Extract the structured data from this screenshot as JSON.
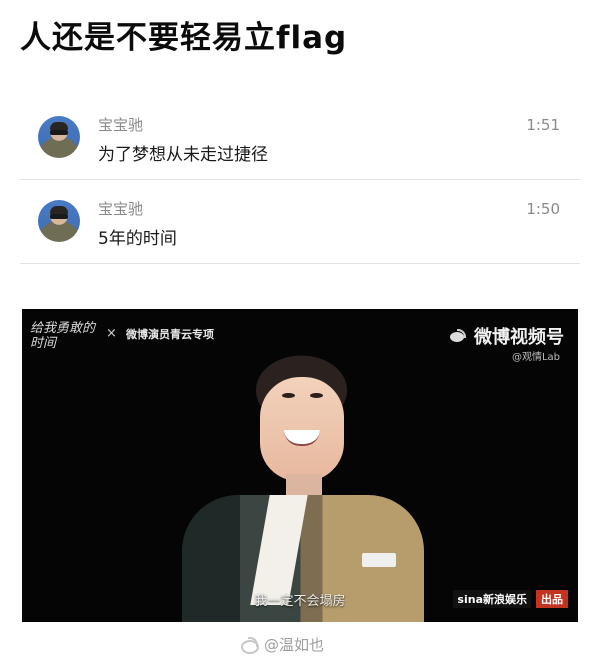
{
  "page": {
    "title": "人还是不要轻易立flag"
  },
  "messages": [
    {
      "sender": "宝宝驰",
      "text": "为了梦想从未走过捷径",
      "time": "1:51",
      "avatar_icon": "sunglasses-avatar"
    },
    {
      "sender": "宝宝驰",
      "text": "5年的时间",
      "time": "1:50",
      "avatar_icon": "sunglasses-avatar"
    }
  ],
  "video": {
    "left_logo": "给我勇敢的时间",
    "collab_x": "×",
    "collab_title": "微博演员青云专项",
    "platform": "微博视频号",
    "platform_sub": "@观情Lab",
    "subtitle": "我一定不会塌房",
    "brand": "sina新浪娱乐",
    "badge": "出品"
  },
  "watermark": {
    "text": "@温如也",
    "icon": "weibo-icon"
  },
  "colors": {
    "text_primary": "#111111",
    "text_secondary": "#8a8a8a",
    "divider": "#e4e4e4",
    "video_bg": "#050505",
    "badge_red": "#c2341f"
  }
}
